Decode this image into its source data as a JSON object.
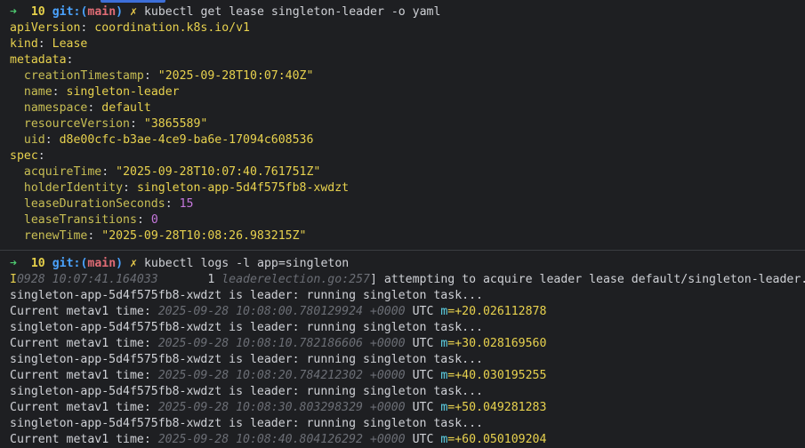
{
  "prompt1": {
    "arrow": "➜",
    "num": "10",
    "git": "git:(",
    "branch": "main",
    "close": ")",
    "x": "✗",
    "cmd": "kubectl get lease singleton-leader -o yaml"
  },
  "yaml": [
    {
      "k": "apiVersion",
      "v": "coordination.k8s.io/v1"
    },
    {
      "k": "kind",
      "v": "Lease"
    },
    {
      "k": "metadata",
      "v": ""
    },
    {
      "k": "creationTimestamp",
      "v": "\"2025-09-28T10:07:40Z\""
    },
    {
      "k": "name",
      "v": "singleton-leader"
    },
    {
      "k": "namespace",
      "v": "default"
    },
    {
      "k": "resourceVersion",
      "v": "\"3865589\""
    },
    {
      "k": "uid",
      "v": "d8e00cfc-b3ae-4ce9-ba6e-17094c608536"
    },
    {
      "k": "spec",
      "v": ""
    },
    {
      "k": "acquireTime",
      "v": "\"2025-09-28T10:07:40.761751Z\""
    },
    {
      "k": "holderIdentity",
      "v": "singleton-app-5d4f575fb8-xwdzt"
    },
    {
      "k": "leaseDurationSeconds",
      "v": "15"
    },
    {
      "k": "leaseTransitions",
      "v": "0"
    },
    {
      "k": "renewTime",
      "v": "\"2025-09-28T10:08:26.983215Z\""
    }
  ],
  "prompt2": {
    "arrow": "➜",
    "num": "10",
    "git": "git:(",
    "branch": "main",
    "close": ")",
    "x": "✗",
    "cmd": "kubectl logs -l app=singleton"
  },
  "log_first": {
    "level": "I",
    "time": "0928 10:07:41.164033",
    "thread": "       1 ",
    "source": "leaderelection.go:257",
    "msg": "] attempting to acquire leader lease default/singleton-leader..."
  },
  "logs": [
    {
      "task": "singleton-app-5d4f575fb8-xwdzt is leader: running singleton task...",
      "label": "Current metav1 time: ",
      "ts": "2025-09-28 10:08:00.780129924 +0000",
      "utc": " UTC ",
      "m": "m",
      "mval": "=+20.026112878"
    },
    {
      "task": "singleton-app-5d4f575fb8-xwdzt is leader: running singleton task...",
      "label": "Current metav1 time: ",
      "ts": "2025-09-28 10:08:10.782186606 +0000",
      "utc": " UTC ",
      "m": "m",
      "mval": "=+30.028169560"
    },
    {
      "task": "singleton-app-5d4f575fb8-xwdzt is leader: running singleton task...",
      "label": "Current metav1 time: ",
      "ts": "2025-09-28 10:08:20.784212302 +0000",
      "utc": " UTC ",
      "m": "m",
      "mval": "=+40.030195255"
    },
    {
      "task": "singleton-app-5d4f575fb8-xwdzt is leader: running singleton task...",
      "label": "Current metav1 time: ",
      "ts": "2025-09-28 10:08:30.803298329 +0000",
      "utc": " UTC ",
      "m": "m",
      "mval": "=+50.049281283"
    },
    {
      "task": "singleton-app-5d4f575fb8-xwdzt is leader: running singleton task...",
      "label": "Current metav1 time: ",
      "ts": "2025-09-28 10:08:40.804126292 +0000",
      "utc": " UTC ",
      "m": "m",
      "mval": "=+60.050109204"
    }
  ]
}
